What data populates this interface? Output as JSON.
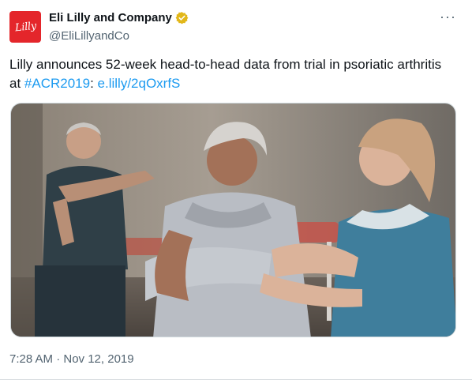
{
  "tweet": {
    "avatar_text": "Lilly",
    "display_name": "Eli Lilly and Company",
    "handle": "@EliLillyandCo",
    "more_label": "···",
    "text_main": "Lilly announces 52-week head-to-head data from trial in psoriatic arthritis at ",
    "hashtag": "#ACR2019",
    "separator": ": ",
    "link": "e.lilly/2qOxrfS",
    "timestamp": "7:28 AM · Nov 12, 2019",
    "verified_color": "#e2b719",
    "link_color": "#1d9bf0"
  }
}
